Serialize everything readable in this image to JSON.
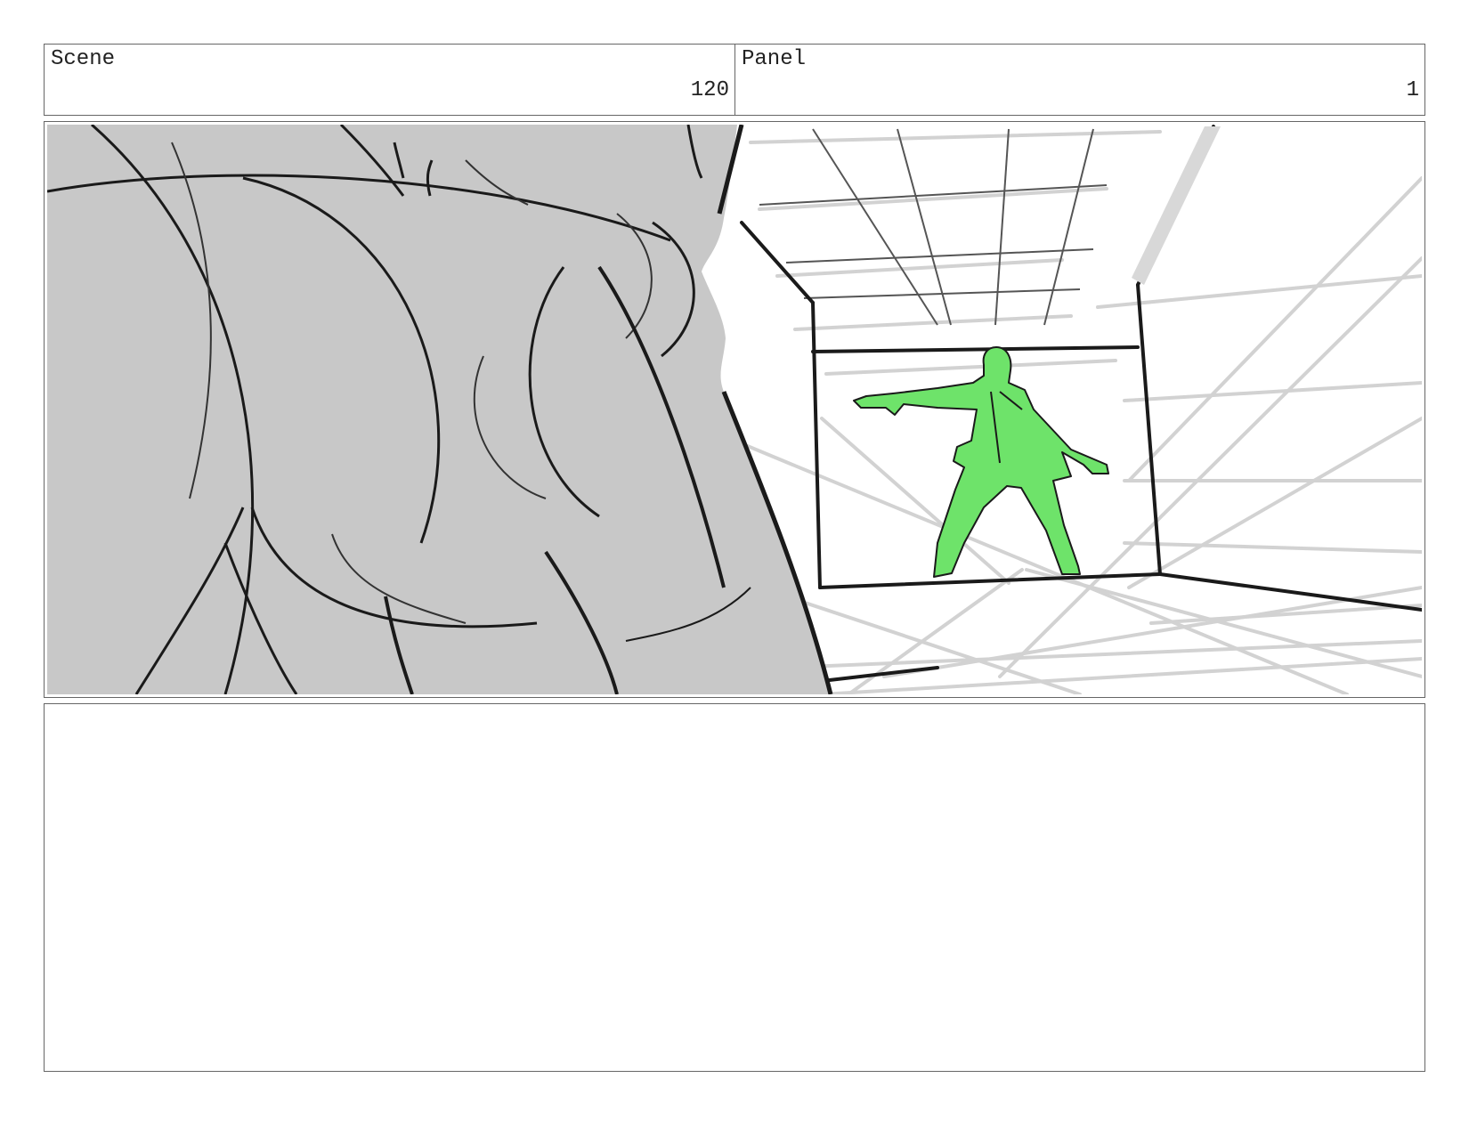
{
  "header": {
    "scene_label": "Scene",
    "scene_number": "120",
    "panel_label": "Panel",
    "panel_number": "1"
  },
  "colors": {
    "frame_border": "#666666",
    "foreground_figure": "#c8c8c8",
    "background_figure": "#6ee36a",
    "sketch_line": "#1a1a1a",
    "perspective_line": "#cfcfcf"
  },
  "notes": {
    "text": ""
  }
}
